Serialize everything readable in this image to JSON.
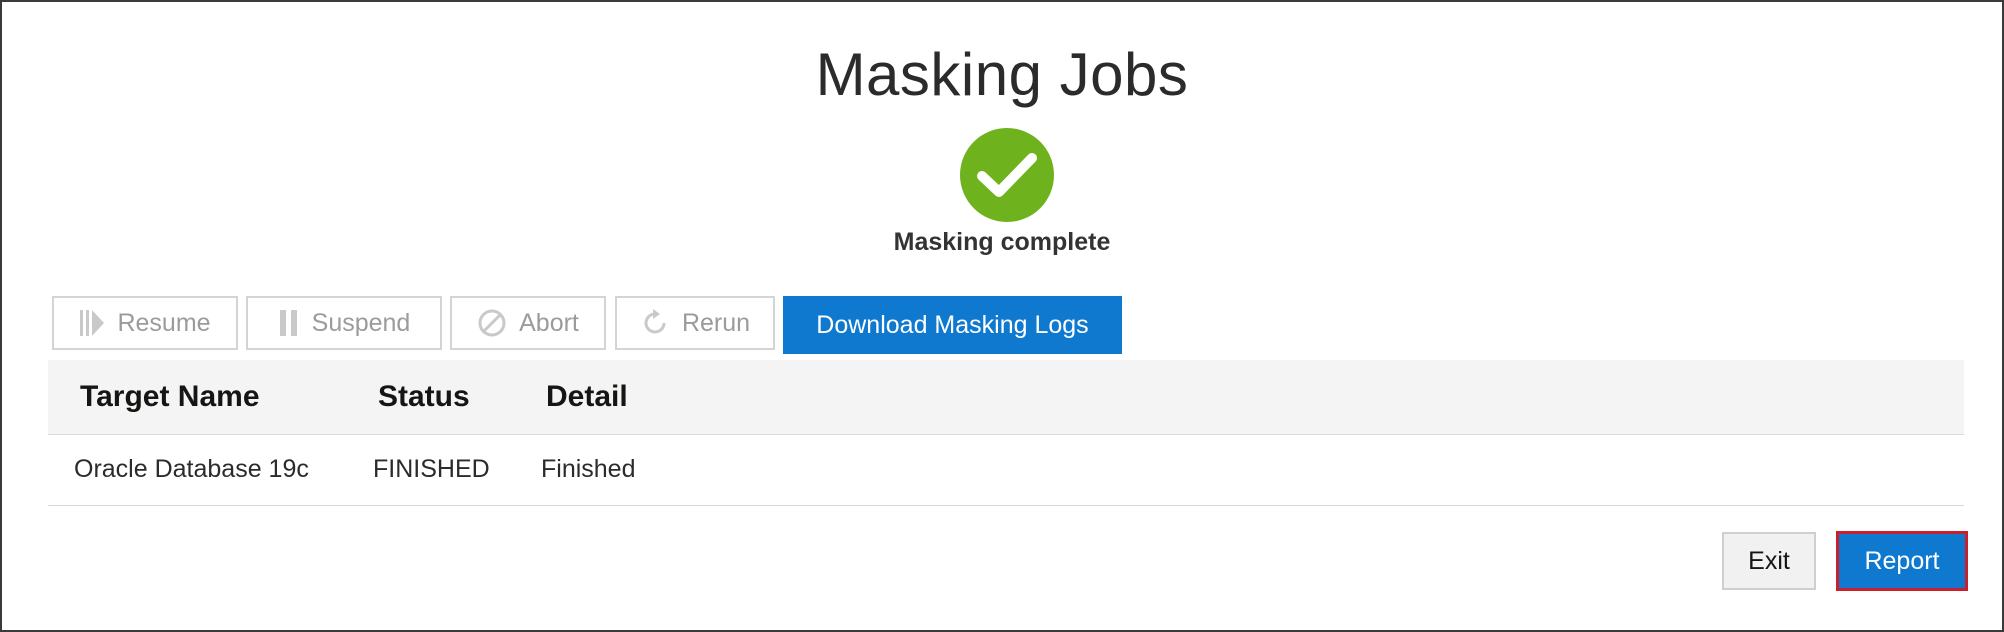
{
  "page": {
    "title": "Masking Jobs",
    "status_message": "Masking complete"
  },
  "toolbar": {
    "resume_label": "Resume",
    "suspend_label": "Suspend",
    "abort_label": "Abort",
    "rerun_label": "Rerun",
    "download_label": "Download Masking Logs"
  },
  "table": {
    "headers": [
      "Target Name",
      "Status",
      "Detail"
    ],
    "rows": [
      [
        "Oracle Database 19c",
        "FINISHED",
        "Finished"
      ]
    ]
  },
  "footer": {
    "exit_label": "Exit",
    "report_label": "Report"
  },
  "colors": {
    "accent": "#0f79cf",
    "success": "#6eb21e",
    "highlight_border": "#c8202d"
  }
}
